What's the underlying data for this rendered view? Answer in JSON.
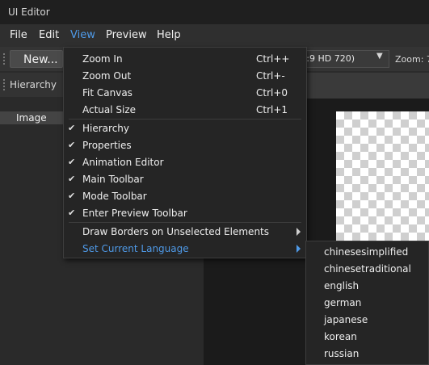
{
  "window": {
    "title": "UI Editor"
  },
  "menubar": {
    "items": [
      {
        "label": "File",
        "active": false
      },
      {
        "label": "Edit",
        "active": false
      },
      {
        "label": "View",
        "active": true
      },
      {
        "label": "Preview",
        "active": false
      },
      {
        "label": "Help",
        "active": false
      }
    ]
  },
  "toolbar": {
    "new_label": "New...",
    "resolution_value": "(:9 HD 720)",
    "zoom_label": "Zoom: 7"
  },
  "hierarchy": {
    "panel_title": "Hierarchy",
    "items": [
      {
        "label": "Image",
        "selected": true
      }
    ]
  },
  "view_menu": {
    "zoom_group": [
      {
        "label": "Zoom In",
        "shortcut": "Ctrl++"
      },
      {
        "label": "Zoom Out",
        "shortcut": "Ctrl+-"
      },
      {
        "label": "Fit Canvas",
        "shortcut": "Ctrl+0"
      },
      {
        "label": "Actual Size",
        "shortcut": "Ctrl+1"
      }
    ],
    "panel_group": [
      {
        "label": "Hierarchy",
        "checked": true
      },
      {
        "label": "Properties",
        "checked": true
      },
      {
        "label": "Animation Editor",
        "checked": true
      },
      {
        "label": "Main Toolbar",
        "checked": true
      },
      {
        "label": "Mode Toolbar",
        "checked": true
      },
      {
        "label": "Enter Preview Toolbar",
        "checked": true
      }
    ],
    "submenu_group": [
      {
        "label": "Draw Borders on Unselected Elements",
        "highlighted": false
      },
      {
        "label": "Set Current Language",
        "highlighted": true
      }
    ],
    "check_glyph": "✔"
  },
  "language_submenu": {
    "items": [
      "chinesesimplified",
      "chinesetraditional",
      "english",
      "german",
      "japanese",
      "korean",
      "russian"
    ]
  },
  "colors": {
    "accent": "#4f9ae8",
    "menu_bg": "#252525",
    "window_bg": "#2b2b2b"
  }
}
